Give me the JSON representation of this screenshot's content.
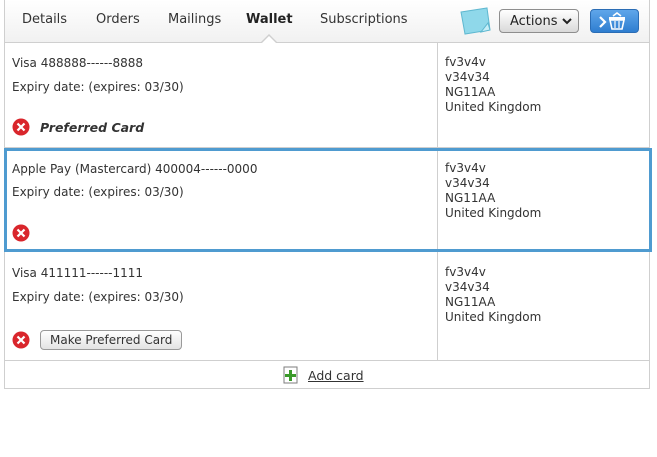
{
  "tabs": [
    {
      "label": "Details",
      "active": false
    },
    {
      "label": "Orders",
      "active": false
    },
    {
      "label": "Mailings",
      "active": false
    },
    {
      "label": "Wallet",
      "active": true
    },
    {
      "label": "Subscriptions",
      "active": false
    }
  ],
  "toolbar": {
    "note_icon": "sticky-note-icon",
    "actions_label": "Actions",
    "basket_icon": "basket-icon"
  },
  "cards": [
    {
      "name": "Visa 488888------8888",
      "expiry": "Expiry date: (expires: 03/30)",
      "preferred_label": "Preferred Card",
      "address": [
        "fv3v4v",
        "v34v34",
        "NG11AA",
        "United Kingdom"
      ]
    },
    {
      "name": "Apple Pay (Mastercard) 400004------0000",
      "expiry": "Expiry date: (expires: 03/30)",
      "address": [
        "fv3v4v",
        "v34v34",
        "NG11AA",
        "United Kingdom"
      ]
    },
    {
      "name": "Visa 411111------1111",
      "expiry": "Expiry date: (expires: 03/30)",
      "make_preferred_label": "Make Preferred Card",
      "address": [
        "fv3v4v",
        "v34v34",
        "NG11AA",
        "United Kingdom"
      ]
    }
  ],
  "footer": {
    "add_card_label": "Add card"
  },
  "colors": {
    "selected_border": "#4f9bd0",
    "delete_red": "#d9262c",
    "add_green": "#3a9a2a",
    "primary_blue": "#2f7ed0"
  }
}
